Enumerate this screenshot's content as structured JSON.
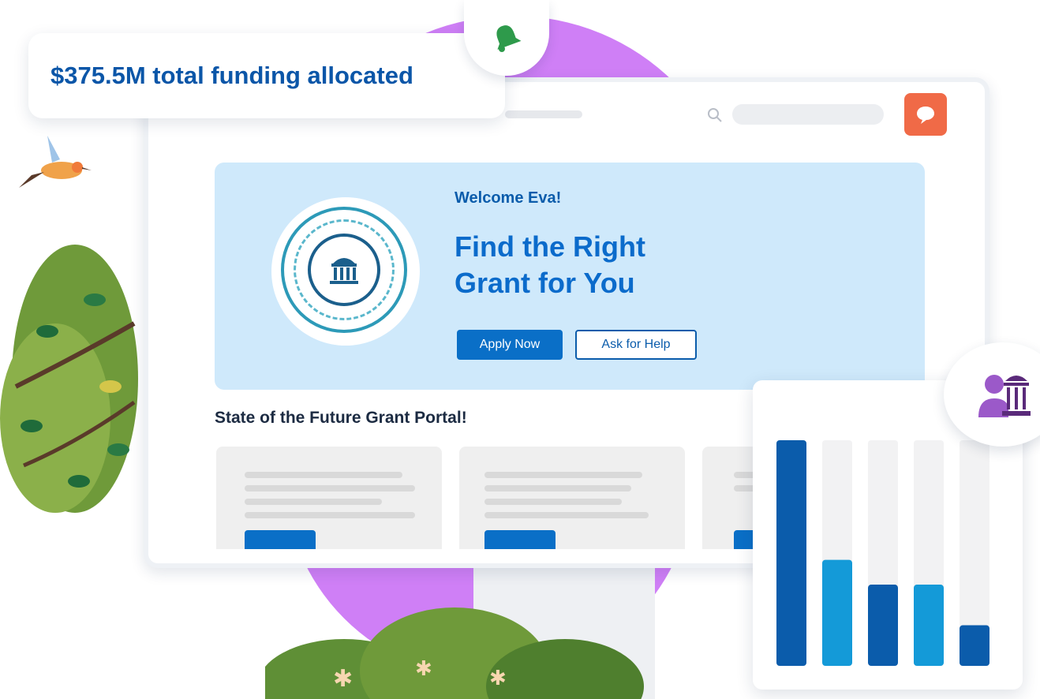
{
  "funding_banner": {
    "text": "$375.5M total funding allocated"
  },
  "hero": {
    "greeting": "Welcome Eva!",
    "headline_line1": "Find the Right",
    "headline_line2": "Grant for You",
    "primary_button": "Apply Now",
    "secondary_button": "Ask for Help"
  },
  "section": {
    "title": "State of the Future Grant Portal!"
  },
  "icons": {
    "bell": "bell-icon",
    "search": "search-icon",
    "profile": "chat-bubble-icon",
    "seal": "capitol-building-icon",
    "person": "person-with-building-icon"
  },
  "colors": {
    "accent": "#0a6fc7",
    "hero_bg": "#cfe9fb",
    "purple": "#cf7ff6",
    "orange": "#f06a47",
    "bar_dark": "#0b5cab",
    "bar_light": "#149ad8",
    "bar_track": "#f2f2f3"
  },
  "chart_data": {
    "type": "bar",
    "categories": [
      "",
      "",
      "",
      "",
      ""
    ],
    "values": [
      100,
      47,
      36,
      36,
      18
    ],
    "ylim": [
      0,
      100
    ],
    "bar_colors": [
      "#0b5cab",
      "#149ad8",
      "#0b5cab",
      "#149ad8",
      "#0b5cab"
    ],
    "title": "",
    "xlabel": "",
    "ylabel": "",
    "grid": false
  }
}
